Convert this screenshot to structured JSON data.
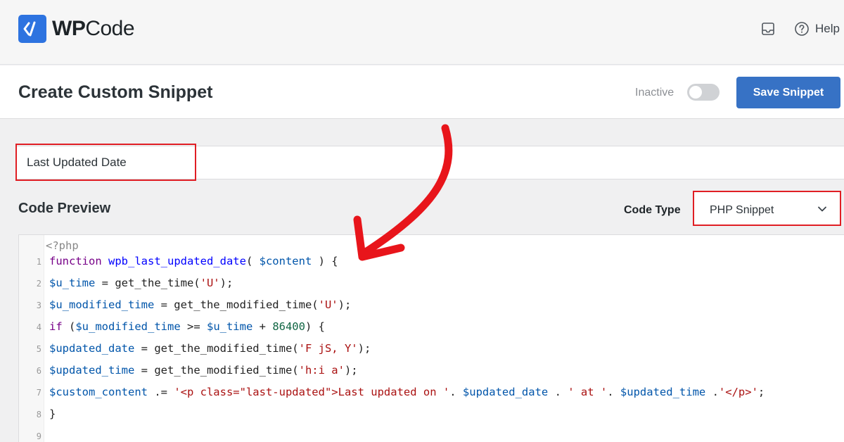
{
  "app": {
    "name_bold": "WP",
    "name_rest": "Code"
  },
  "topbar": {
    "help_label": "Help"
  },
  "header": {
    "title": "Create Custom Snippet",
    "status_label": "Inactive",
    "active": false,
    "save_label": "Save Snippet"
  },
  "snippet": {
    "title_value": "Last Updated Date"
  },
  "code_preview": {
    "heading": "Code Preview",
    "code_type_label": "Code Type",
    "code_type_value": "PHP Snippet"
  },
  "editor": {
    "open_tag": "<?php",
    "line_numbers": [
      "1",
      "2",
      "3",
      "4",
      "5",
      "6",
      "7",
      "8",
      "9"
    ],
    "lines": [
      [
        [
          "k",
          "function"
        ],
        [
          "t",
          " "
        ],
        [
          "d",
          "wpb_last_updated_date"
        ],
        [
          "t",
          "( "
        ],
        [
          "v",
          "$content"
        ],
        [
          "t",
          " ) {"
        ]
      ],
      [
        [
          "v",
          "$u_time"
        ],
        [
          "t",
          " = get_the_time("
        ],
        [
          "s",
          "'U'"
        ],
        [
          "t",
          ");"
        ]
      ],
      [
        [
          "v",
          "$u_modified_time"
        ],
        [
          "t",
          " = get_the_modified_time("
        ],
        [
          "s",
          "'U'"
        ],
        [
          "t",
          ");"
        ]
      ],
      [
        [
          "k",
          "if"
        ],
        [
          "t",
          " ("
        ],
        [
          "v",
          "$u_modified_time"
        ],
        [
          "t",
          " >= "
        ],
        [
          "v",
          "$u_time"
        ],
        [
          "t",
          " + "
        ],
        [
          "n",
          "86400"
        ],
        [
          "t",
          ") {"
        ]
      ],
      [
        [
          "v",
          "$updated_date"
        ],
        [
          "t",
          " = get_the_modified_time("
        ],
        [
          "s",
          "'F jS, Y'"
        ],
        [
          "t",
          ");"
        ]
      ],
      [
        [
          "v",
          "$updated_time"
        ],
        [
          "t",
          " = get_the_modified_time("
        ],
        [
          "s",
          "'h:i a'"
        ],
        [
          "t",
          ");"
        ]
      ],
      [
        [
          "v",
          "$custom_content"
        ],
        [
          "t",
          " .= "
        ],
        [
          "s",
          "'<p class=\"last-updated\">Last updated on '"
        ],
        [
          "t",
          ". "
        ],
        [
          "v",
          "$updated_date"
        ],
        [
          "t",
          " . "
        ],
        [
          "s",
          "' at '"
        ],
        [
          "t",
          ". "
        ],
        [
          "v",
          "$updated_time"
        ],
        [
          "t",
          " ."
        ],
        [
          "s",
          "'</p>'"
        ],
        [
          "t",
          ";"
        ]
      ],
      [
        [
          "t",
          "}"
        ]
      ],
      []
    ]
  },
  "colors": {
    "brand_blue": "#2d73e0",
    "save_button": "#3772c5",
    "highlight_red": "#e01e24",
    "arrow_red": "#e8151b"
  },
  "icons": {
    "logo": "code-brackets-icon",
    "inbox": "inbox-icon",
    "help": "help-circle-icon",
    "select": "chevron-down-icon"
  }
}
